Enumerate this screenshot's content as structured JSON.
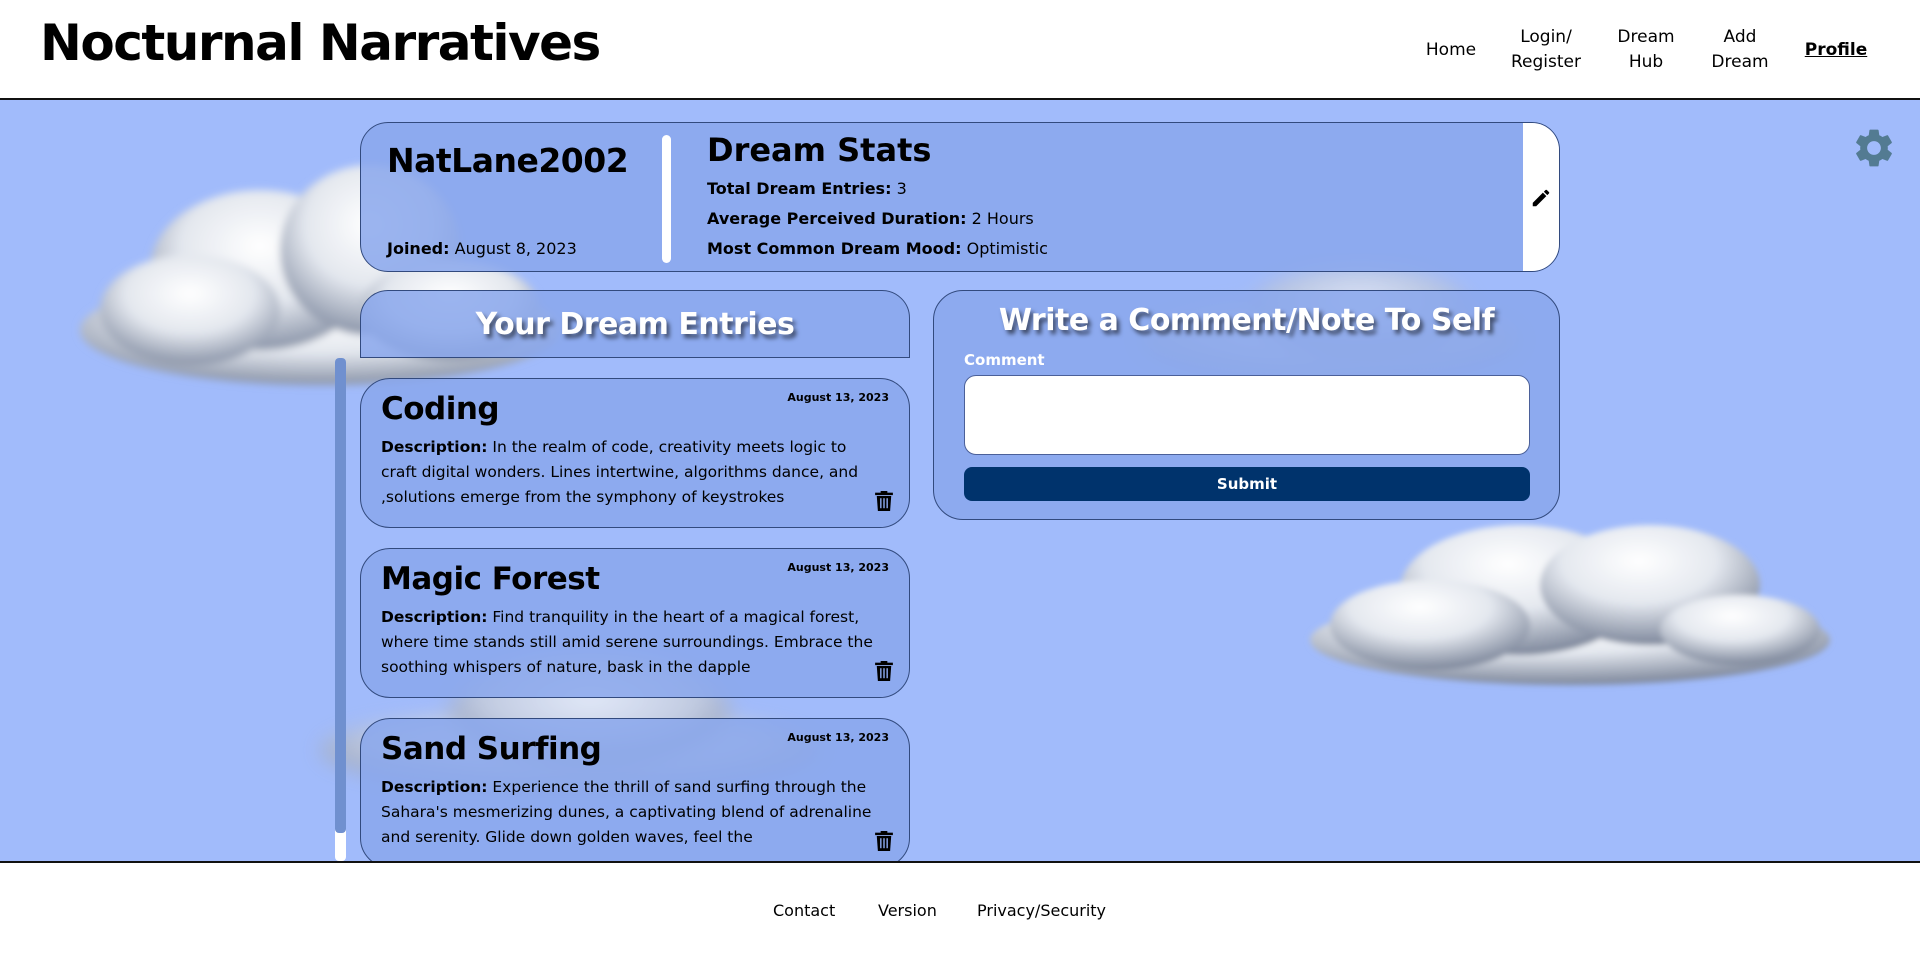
{
  "header": {
    "brand": "Nocturnal Narratives",
    "nav": [
      {
        "label": "Home"
      },
      {
        "label": "Login/\nRegister"
      },
      {
        "label": "Dream\nHub"
      },
      {
        "label": "Add\nDream"
      },
      {
        "label": "Profile",
        "active": true
      }
    ]
  },
  "profile": {
    "username": "NatLane2002",
    "joined_label": "Joined:",
    "joined_value": "August 8, 2023",
    "stats_title": "Dream Stats",
    "stats": [
      {
        "label": "Total Dream Entries:",
        "value": "3"
      },
      {
        "label": "Average Perceived Duration:",
        "value": "2 Hours"
      },
      {
        "label": "Most Common Dream Mood:",
        "value": "Optimistic"
      }
    ]
  },
  "entries": {
    "title": "Your Dream Entries",
    "desc_label": "Description:",
    "items": [
      {
        "title": "Coding",
        "date": "August 13, 2023",
        "description": "In the realm of code, creativity meets logic to craft digital wonders. Lines intertwine, algorithms dance, and ,solutions emerge from the symphony of keystrokes"
      },
      {
        "title": "Magic Forest",
        "date": "August 13, 2023",
        "description": "Find tranquility in the heart of a magical forest, where time stands still amid serene surroundings. Embrace the soothing whispers of nature, bask in the dapple"
      },
      {
        "title": "Sand Surfing",
        "date": "August 13, 2023",
        "description": "Experience the thrill of sand surfing through the Sahara's mesmerizing dunes, a captivating blend of adrenaline and serenity. Glide down golden waves, feel the"
      }
    ]
  },
  "comment": {
    "title": "Write a Comment/Note To Self",
    "label": "Comment",
    "value": "",
    "submit_label": "Submit"
  },
  "footer": {
    "links": [
      {
        "label": "Contact"
      },
      {
        "label": "Version"
      },
      {
        "label": "Privacy/Security"
      }
    ]
  },
  "colors": {
    "sky": "#a1bbfb",
    "card": "#89a7ec",
    "submit": "#00336c"
  }
}
